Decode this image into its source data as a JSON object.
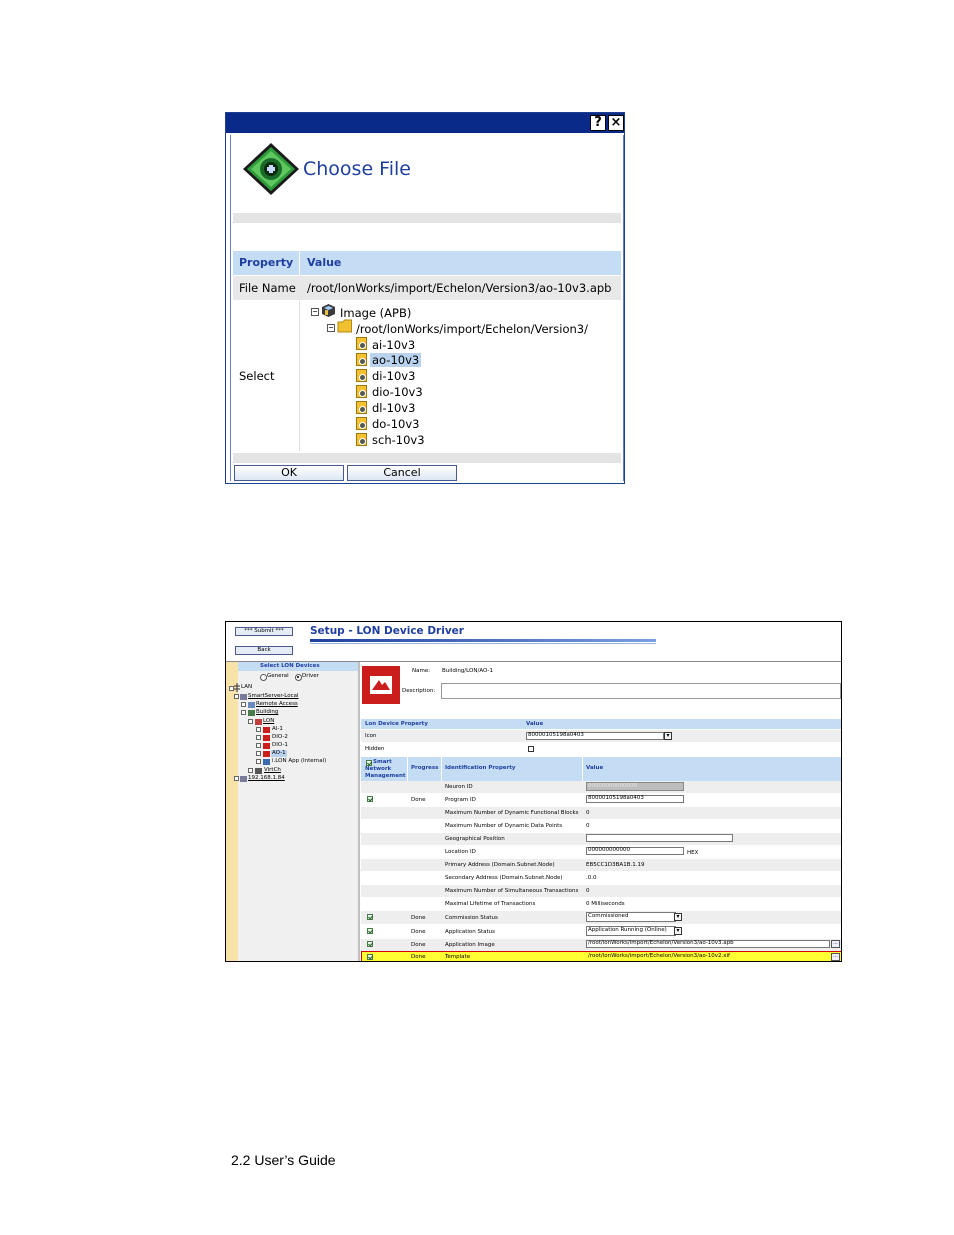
{
  "dialog": {
    "help_glyph": "?",
    "close_glyph": "×",
    "title": "Choose File",
    "table": {
      "col_property": "Property",
      "col_value": "Value",
      "rows": [
        {
          "property": "File Name",
          "value": "/root/lonWorks/import/Echelon/Version3/ao-10v3.apb"
        },
        {
          "property": "Select"
        }
      ]
    },
    "tree": {
      "root_label": "Image (APB)",
      "folder_label": "/root/lonWorks/import/Echelon/Version3/",
      "files": [
        "ai-10v3",
        "ao-10v3",
        "di-10v3",
        "dio-10v3",
        "dl-10v3",
        "do-10v3",
        "sch-10v3"
      ],
      "selected_file": "ao-10v3"
    },
    "ok_label": "OK",
    "cancel_label": "Cancel",
    "colors": {
      "titlebar": "#0a2a8a",
      "header": "#c4dcf4",
      "title_text": "#1f3fa0"
    }
  },
  "setup": {
    "submit_label": "*** Submit ***",
    "back_label": "Back",
    "title": "Setup - LON Device Driver",
    "left_pane": {
      "header": "Select LON Devices",
      "radio_general": "General",
      "radio_driver": "Driver",
      "tree": {
        "lan": "LAN",
        "smartserver": "SmartServer-Local",
        "remote_access": "Remote Access",
        "building": "Building",
        "lon": "LON",
        "ai1": "AI-1",
        "dio2": "DIO-2",
        "dio1": "DIO-1",
        "ao1": "AO-1",
        "ilon_app": "i.LON App (Internal)",
        "virtch": "VirtCh",
        "ip": "192.168.1.84"
      }
    },
    "name_label": "Name:",
    "name_value": "Building/LON/AO-1",
    "description_label": "Description:",
    "prop_table": {
      "col_property": "Lon Device Property",
      "col_value": "Value",
      "icon_label": "Icon",
      "icon_value": "80000105198a0403",
      "hidden_label": "Hidden"
    },
    "id_table": {
      "col_smart": "Smart Network Management",
      "col_progress": "Progress",
      "col_property": "Identification Property",
      "col_value": "Value",
      "rows": [
        {
          "progress": "",
          "property": "Neuron ID",
          "value": "00000000000000"
        },
        {
          "progress": "Done",
          "property": "Program ID",
          "value": "80000105198a0403"
        },
        {
          "progress": "",
          "property": "Maximum Number of Dynamic Functional Blocks",
          "value": "0"
        },
        {
          "progress": "",
          "property": "Maximum Number of Dynamic Data Points",
          "value": "0"
        },
        {
          "progress": "",
          "property": "Geographical Position",
          "value": ""
        },
        {
          "progress": "",
          "property": "Location ID",
          "value": "000000000000",
          "suffix": "HEX"
        },
        {
          "progress": "",
          "property": "Primary Address (Domain.Subnet.Node)",
          "value": "EB5CC1D3BA1B.1.19"
        },
        {
          "progress": "",
          "property": "Secondary Address (Domain.Subnet.Node)",
          "value": ".0.0"
        },
        {
          "progress": "",
          "property": "Maximum Number of Simultaneous Transactions",
          "value": "0"
        },
        {
          "progress": "",
          "property": "Maximal Lifetime of Transactions",
          "value": "0 Milliseconds"
        },
        {
          "progress": "Done",
          "property": "Commission Status",
          "value": "Commissioned"
        },
        {
          "progress": "Done",
          "property": "Application Status",
          "value": "Application Running (Online)"
        },
        {
          "progress": "Done",
          "property": "Application Image",
          "value": "/root/lonWorks/import/Echelon/Version3/ao-10v3.apb"
        },
        {
          "progress": "Done",
          "property": "Template",
          "value": "/root/lonWorks/import/Echelon/Version3/ao-10v2.xif"
        }
      ]
    },
    "browse_glyph": "...",
    "dropdown_glyph": "▾",
    "colors": {
      "highlight": "#ffff33",
      "highlight_border": "#d40000",
      "device_icon": "#cc1d1d"
    }
  },
  "footer": {
    "text": "2.2 User’s Guide"
  }
}
